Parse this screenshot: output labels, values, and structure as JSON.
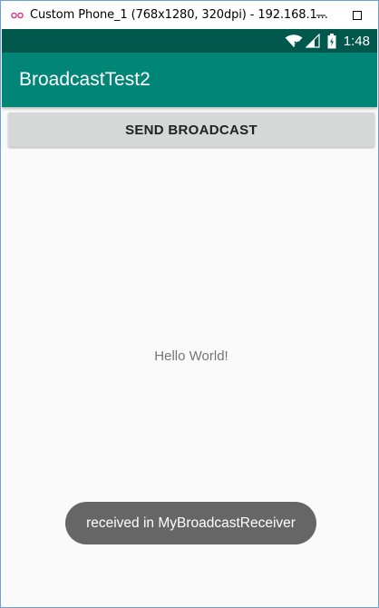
{
  "window": {
    "title": "Custom Phone_1 (768x1280, 320dpi) - 192.168.1...",
    "icon": "emulator-icon",
    "minimize_icon": "minimize-icon",
    "maximize_icon": "maximize-icon"
  },
  "statusbar": {
    "time": "1:48",
    "icons": [
      "wifi-icon",
      "signal-icon",
      "battery-icon"
    ]
  },
  "appbar": {
    "title": "BroadcastTest2"
  },
  "main": {
    "send_button_label": "SEND BROADCAST",
    "hello_text": "Hello World!"
  },
  "toast": {
    "text": "received in MyBroadcastReceiver"
  },
  "colors": {
    "status_bar": "#00574b",
    "app_bar": "#008577",
    "button": "#d6d7d7",
    "toast": "#666666"
  }
}
